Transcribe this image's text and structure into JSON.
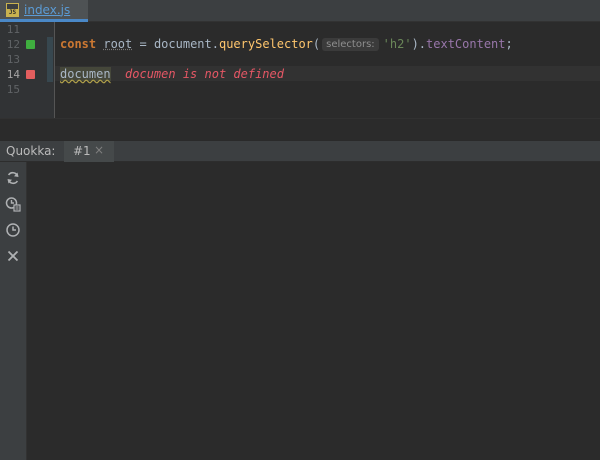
{
  "tab": {
    "filename": "index.js",
    "icon": "js-file-icon",
    "icon_text": "JS"
  },
  "editor": {
    "line_numbers": [
      "11",
      "12",
      "13",
      "14",
      "15"
    ],
    "current_line": "14",
    "line12": {
      "keyword": "const",
      "variable": "root",
      "eq": " = ",
      "object": "document.",
      "method": "querySelector",
      "open": "(",
      "param_hint": "selectors:",
      "string": "'h2'",
      "close": ").",
      "property": "textContent",
      "semicolon": ";"
    },
    "line14": {
      "code": "documen",
      "error_message": "documen is not defined"
    },
    "markers": {
      "line12": "green",
      "line14": "red"
    }
  },
  "quokka": {
    "title": "Quokka:",
    "tab_label": "#1",
    "tab_close": "×",
    "toolbar": [
      "refresh-icon",
      "coverage-timer-icon",
      "clock-icon",
      "close-icon"
    ]
  },
  "colors": {
    "accent": "#4a88c7",
    "keyword": "#cc7832",
    "method": "#ffc66d",
    "string": "#6a8759",
    "property": "#9876aa",
    "error": "#e55765",
    "marker_green": "#3fae3f",
    "marker_red": "#e35e5e"
  }
}
